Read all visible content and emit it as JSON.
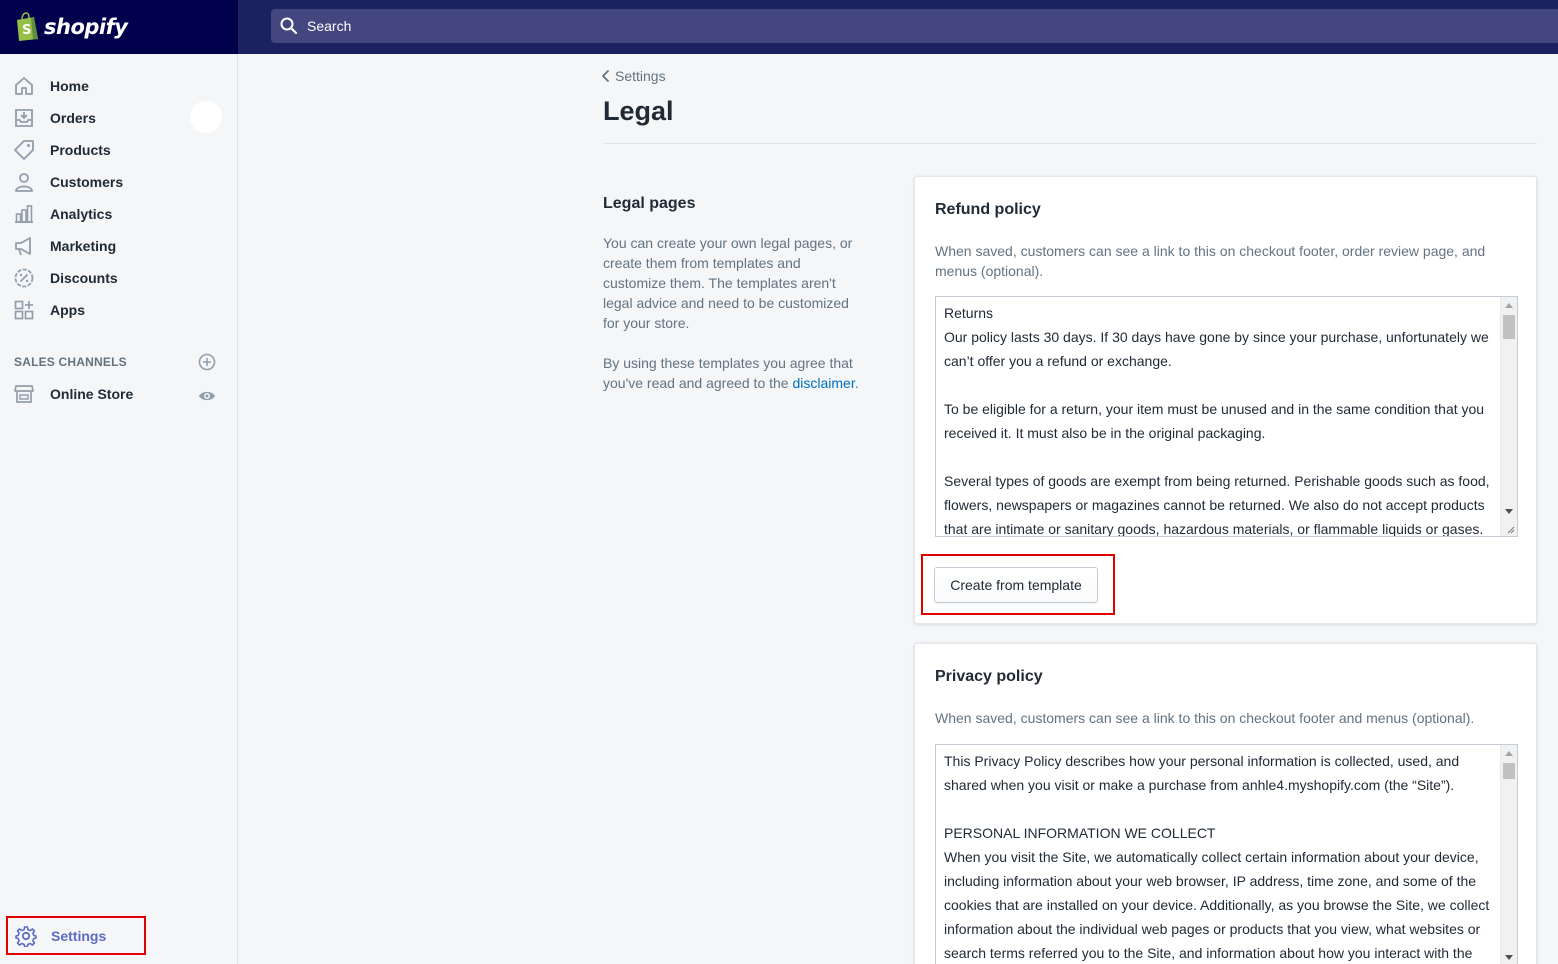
{
  "brand": {
    "name": "shopify"
  },
  "search": {
    "placeholder": "Search"
  },
  "sidebar": {
    "items": [
      {
        "label": "Home",
        "icon": "home-icon"
      },
      {
        "label": "Orders",
        "icon": "orders-icon"
      },
      {
        "label": "Products",
        "icon": "tag-icon"
      },
      {
        "label": "Customers",
        "icon": "person-icon"
      },
      {
        "label": "Analytics",
        "icon": "bar-chart-icon"
      },
      {
        "label": "Marketing",
        "icon": "megaphone-icon"
      },
      {
        "label": "Discounts",
        "icon": "discount-icon"
      },
      {
        "label": "Apps",
        "icon": "apps-icon"
      }
    ],
    "sales_channels_header": "SALES CHANNELS",
    "online_store": "Online Store",
    "settings": "Settings"
  },
  "breadcrumb": {
    "label": "Settings"
  },
  "page": {
    "title": "Legal"
  },
  "legal_pages": {
    "title": "Legal pages",
    "description": "You can create your own legal pages, or create them from templates and customize them. The templates aren't legal advice and need to be customized for your store.",
    "agreement_text": "By using these templates you agree that you've read and agreed to the",
    "disclaimer_link": "disclaimer",
    "period": "."
  },
  "refund_policy": {
    "title": "Refund policy",
    "help": "When saved, customers can see a link to this on checkout footer, order review page, and menus (optional).",
    "content": "Returns\nOur policy lasts 30 days. If 30 days have gone by since your purchase, unfortunately we can’t offer you a refund or exchange.\n\nTo be eligible for a return, your item must be unused and in the same condition that you received it. It must also be in the original packaging.\n\nSeveral types of goods are exempt from being returned. Perishable goods such as food, flowers, newspapers or magazines cannot be returned. We also do not accept products that are intimate or sanitary goods, hazardous materials, or flammable liquids or gases.",
    "button_label": "Create from template"
  },
  "privacy_policy": {
    "title": "Privacy policy",
    "help": "When saved, customers can see a link to this on checkout footer and menus (optional).",
    "content": "This Privacy Policy describes how your personal information is collected, used, and shared when you visit or make a purchase from anhle4.myshopify.com (the “Site”).\n\nPERSONAL INFORMATION WE COLLECT\nWhen you visit the Site, we automatically collect certain information about your device, including information about your web browser, IP address, time zone, and some of the cookies that are installed on your device. Additionally, as you browse the Site, we collect information about the individual web pages or products that you view, what websites or search terms referred you to the Site, and information about how you interact with the Site."
  },
  "colors": {
    "topbar": "#1c2260",
    "logo_bg": "#00004c",
    "search_bg": "#43467f",
    "accent": "#5c6ac4",
    "link": "#006fbb",
    "highlight": "#e00000"
  }
}
